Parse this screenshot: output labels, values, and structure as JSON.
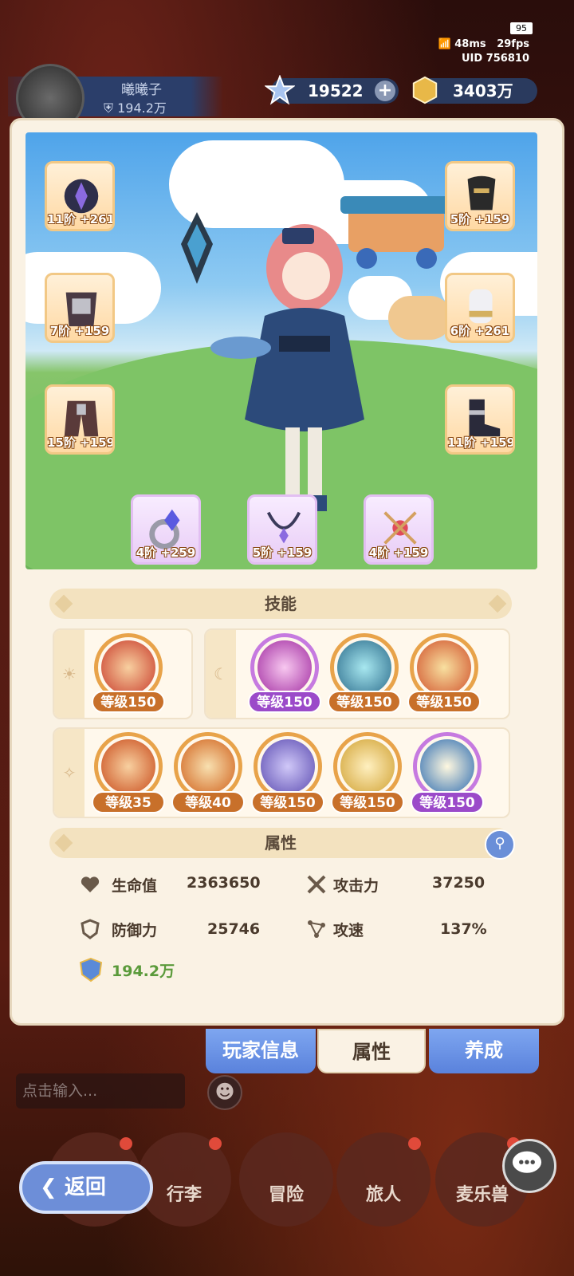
{
  "status": {
    "battery": "95",
    "ping": "48ms",
    "fps": "29fps",
    "uid_label": "UID",
    "uid": "756810"
  },
  "player": {
    "name": "曦曦子",
    "power": "194.2万"
  },
  "resources": {
    "stars": "19522",
    "coins": "3403万"
  },
  "equipment": {
    "left": [
      {
        "label": "11阶 +261",
        "icon": "helmet-icon"
      },
      {
        "label": "7阶 +159",
        "icon": "armor-icon"
      },
      {
        "label": "15阶 +159",
        "icon": "pants-icon"
      }
    ],
    "right": [
      {
        "label": "5阶 +159",
        "icon": "mask-icon"
      },
      {
        "label": "6阶 +261",
        "icon": "gauntlet-icon"
      },
      {
        "label": "11阶 +159",
        "icon": "boots-icon"
      }
    ],
    "bottom": [
      {
        "label": "4阶 +259",
        "icon": "ring-icon"
      },
      {
        "label": "5阶 +159",
        "icon": "necklace-icon"
      },
      {
        "label": "4阶 +159",
        "icon": "charm-icon"
      }
    ]
  },
  "skills_header": "技能",
  "skills": {
    "row1_left": [
      {
        "level": "等级150",
        "color": "#e8a34a"
      }
    ],
    "row1_right": [
      {
        "level": "等级150",
        "color": "#c67ae0"
      },
      {
        "level": "等级150",
        "color": "#e8a34a"
      },
      {
        "level": "等级150",
        "color": "#e8a34a"
      }
    ],
    "row2": [
      {
        "level": "等级35",
        "color": "#e8a34a"
      },
      {
        "level": "等级40",
        "color": "#e8a34a"
      },
      {
        "level": "等级150",
        "color": "#e8a34a"
      },
      {
        "level": "等级150",
        "color": "#e8a34a"
      },
      {
        "level": "等级150",
        "color": "#c67ae0"
      }
    ]
  },
  "attributes_header": "属性",
  "attributes": {
    "hp_label": "生命值",
    "hp_value": "2363650",
    "atk_label": "攻击力",
    "atk_value": "37250",
    "def_label": "防御力",
    "def_value": "25746",
    "spd_label": "攻速",
    "spd_value": "137%",
    "power_value": "194.2万"
  },
  "tabs": [
    "玩家信息",
    "属性",
    "养成"
  ],
  "chat_placeholder": "点击输入...",
  "nav": [
    "行李",
    "冒险",
    "旅人",
    "麦乐兽"
  ],
  "back_label": "返回"
}
